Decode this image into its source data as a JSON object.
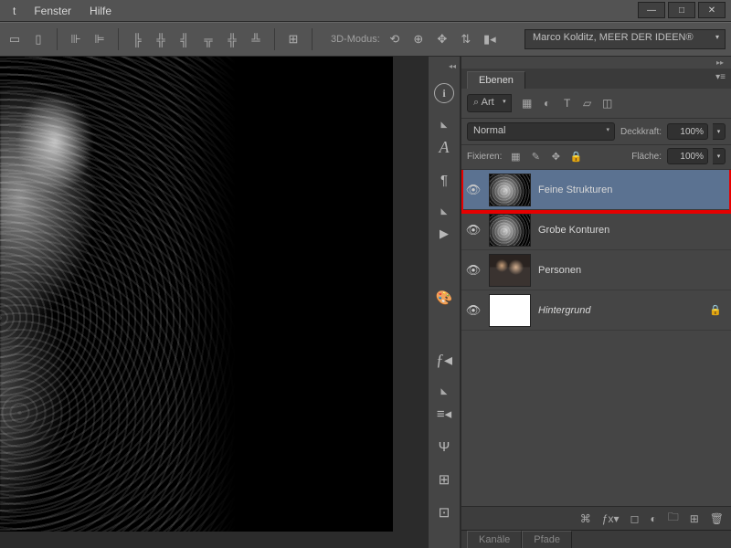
{
  "menu": {
    "items": [
      "t",
      "Fenster",
      "Hilfe"
    ]
  },
  "options": {
    "modus_label": "3D-Modus:",
    "preset": "Marco Kolditz, MEER DER IDEEN®"
  },
  "panels": {
    "layers_tab": "Ebenen",
    "filter_select": "Art",
    "blend_mode": "Normal",
    "opacity_label": "Deckkraft:",
    "opacity_value": "100%",
    "lock_label": "Fixieren:",
    "fill_label": "Fläche:",
    "fill_value": "100%",
    "layers": [
      {
        "name": "Feine Strukturen",
        "visible": true,
        "selected": true,
        "thumb": "edge",
        "locked": false
      },
      {
        "name": "Grobe Konturen",
        "visible": true,
        "selected": false,
        "thumb": "edge",
        "locked": false
      },
      {
        "name": "Personen",
        "visible": true,
        "selected": false,
        "thumb": "people",
        "locked": false
      },
      {
        "name": "Hintergrund",
        "visible": true,
        "selected": false,
        "thumb": "white",
        "locked": true,
        "bg": true
      }
    ],
    "lower_tabs": [
      "Kanäle",
      "Pfade"
    ]
  }
}
